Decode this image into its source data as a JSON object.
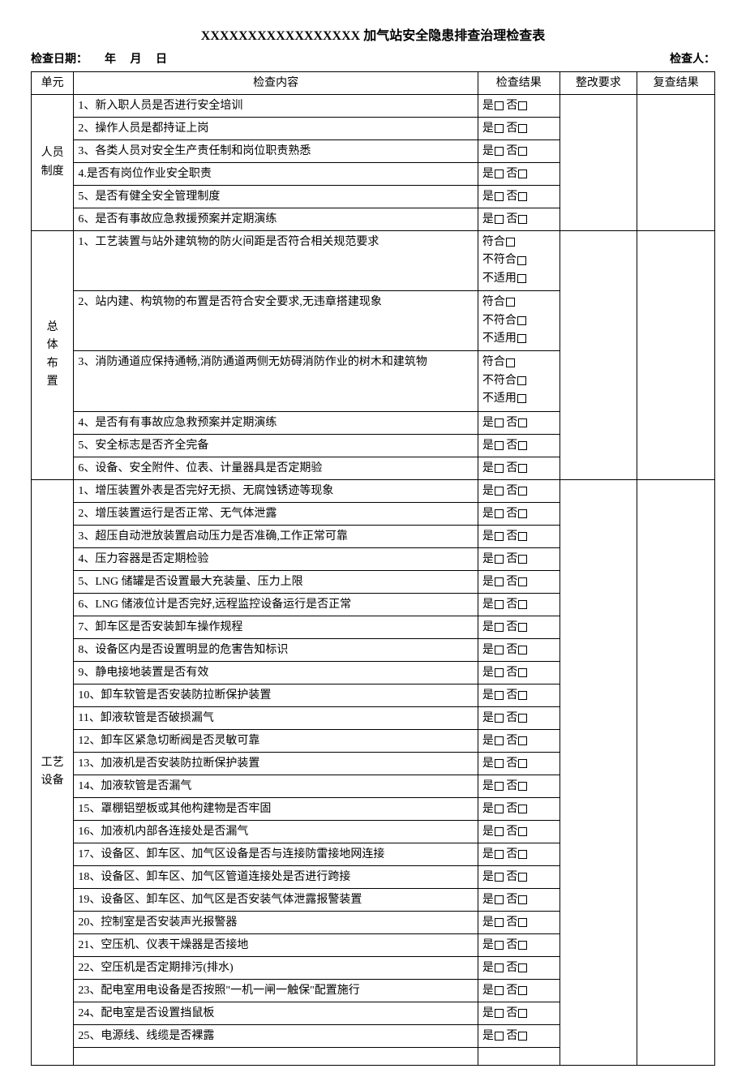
{
  "title": "XXXXXXXXXXXXXXXXX 加气站安全隐患排查治理检查表",
  "meta": {
    "date_label": "检查日期：",
    "year": "年",
    "month": "月",
    "day": "日",
    "inspector_label": "检查人："
  },
  "headers": {
    "unit": "单元",
    "content": "检查内容",
    "result": "检查结果",
    "requirement": "整改要求",
    "recheck": "复查结果"
  },
  "result_labels": {
    "yes": "是",
    "no": "否",
    "conform": "符合",
    "nonconform": "不符合",
    "na": "不适用"
  },
  "sections": [
    {
      "unit": "人员制度",
      "items": [
        {
          "text": "1、新入职人员是否进行安全培训",
          "type": "yn"
        },
        {
          "text": "2、操作人员是都持证上岗",
          "type": "yn"
        },
        {
          "text": "3、各类人员对安全生产责任制和岗位职责熟悉",
          "type": "yn"
        },
        {
          "text": "4.是否有岗位作业安全职责",
          "type": "yn"
        },
        {
          "text": "5、是否有健全安全管理制度",
          "type": "yn"
        },
        {
          "text": "6、是否有事故应急救援预案并定期演练",
          "type": "yn"
        }
      ]
    },
    {
      "unit": "总体布置",
      "items": [
        {
          "text": "1、工艺装置与站外建筑物的防火间距是否符合相关规范要求",
          "type": "cna"
        },
        {
          "text": "2、站内建、构筑物的布置是否符合安全要求,无违章搭建现象",
          "type": "cna"
        },
        {
          "text": "3、消防通道应保持通畅,消防通道两侧无妨碍消防作业的树木和建筑物",
          "type": "cna"
        },
        {
          "text": "4、是否有有事故应急救预案并定期演练",
          "type": "yn"
        },
        {
          "text": "5、安全标志是否齐全完备",
          "type": "yn"
        },
        {
          "text": "6、设备、安全附件、位表、计量器具是否定期验",
          "type": "yn"
        }
      ]
    },
    {
      "unit": "工艺设备",
      "items": [
        {
          "text": "1、增压装置外表是否完好无损、无腐蚀锈迹等现象",
          "type": "yn"
        },
        {
          "text": "2、增压装置运行是否正常、无气体泄露",
          "type": "yn"
        },
        {
          "text": "3、超压自动泄放装置启动压力是否准确,工作正常可靠",
          "type": "yn"
        },
        {
          "text": "4、压力容器是否定期检验",
          "type": "yn"
        },
        {
          "text": "5、LNG 储罐是否设置最大充装量、压力上限",
          "type": "yn"
        },
        {
          "text": "6、LNG 储液位计是否完好,远程监控设备运行是否正常",
          "type": "yn"
        },
        {
          "text": "7、卸车区是否安装卸车操作规程",
          "type": "yn"
        },
        {
          "text": "8、设备区内是否设置明显的危害告知标识",
          "type": "yn"
        },
        {
          "text": "9、静电接地装置是否有效",
          "type": "yn"
        },
        {
          "text": "10、卸车软管是否安装防拉断保护装置",
          "type": "yn"
        },
        {
          "text": "11、卸液软管是否破损漏气",
          "type": "yn"
        },
        {
          "text": "12、卸车区紧急切断阀是否灵敏可靠",
          "type": "yn"
        },
        {
          "text": "13、加液机是否安装防拉断保护装置",
          "type": "yn"
        },
        {
          "text": "14、加液软管是否漏气",
          "type": "yn"
        },
        {
          "text": "15、罩棚铝塑板或其他构建物是否牢固",
          "type": "yn"
        },
        {
          "text": "16、加液机内部各连接处是否漏气",
          "type": "yn"
        },
        {
          "text": "17、设备区、卸车区、加气区设备是否与连接防雷接地网连接",
          "type": "yn"
        },
        {
          "text": "18、设备区、卸车区、加气区管道连接处是否进行跨接",
          "type": "yn"
        },
        {
          "text": "19、设备区、卸车区、加气区是否安装气体泄露报警装置",
          "type": "yn"
        },
        {
          "text": "20、控制室是否安装声光报警器",
          "type": "yn"
        },
        {
          "text": "21、空压机、仪表干燥器是否接地",
          "type": "yn"
        },
        {
          "text": "22、空压机是否定期排污(排水)",
          "type": "yn"
        },
        {
          "text": "23、配电室用电设备是否按照\"一机一闸一触保\"配置施行",
          "type": "yn"
        },
        {
          "text": "24、配电室是否设置挡鼠板",
          "type": "yn"
        },
        {
          "text": "25、电源线、线缆是否裸露",
          "type": "yn"
        }
      ]
    }
  ]
}
